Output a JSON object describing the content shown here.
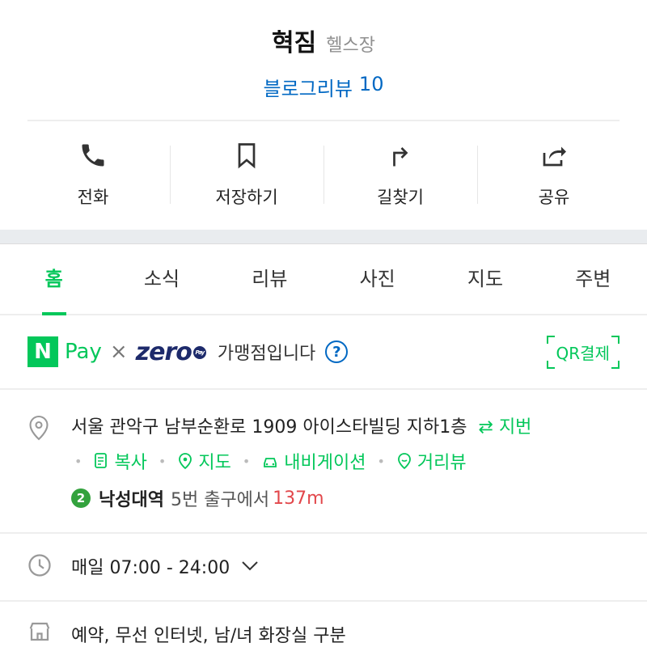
{
  "place": {
    "name": "혁짐",
    "category": "헬스장",
    "blog_review_label": "블로그리뷰",
    "blog_review_count": "10"
  },
  "actions": [
    {
      "label": "전화",
      "icon": "phone-icon"
    },
    {
      "label": "저장하기",
      "icon": "bookmark-icon"
    },
    {
      "label": "길찾기",
      "icon": "directions-icon"
    },
    {
      "label": "공유",
      "icon": "share-icon"
    }
  ],
  "tabs": [
    {
      "label": "홈",
      "active": true
    },
    {
      "label": "소식",
      "active": false
    },
    {
      "label": "리뷰",
      "active": false
    },
    {
      "label": "사진",
      "active": false
    },
    {
      "label": "지도",
      "active": false
    },
    {
      "label": "주변",
      "active": false
    }
  ],
  "payment": {
    "npay_mark": "N",
    "npay_text": "Pay",
    "x_mark": "×",
    "zero_text": "zero",
    "zero_badge": "Pay",
    "suffix": "가맹점입니다",
    "help_symbol": "?",
    "qr_label": "QR결제"
  },
  "address": {
    "text": "서울 관악구 남부순환로 1909 아이스타빌딩 지하1층",
    "jibun_label": "⇄ 지번",
    "links": [
      "복사",
      "지도",
      "내비게이션",
      "거리뷰"
    ],
    "subway_line": "2",
    "station": "낙성대역",
    "exit": "5번 출구에서",
    "distance": "137m"
  },
  "hours": {
    "text": "매일 07:00 - 24:00"
  },
  "amenities": {
    "text": "예약, 무선 인터넷, 남/녀 화장실 구분"
  },
  "colors": {
    "brand_green": "#03c75a",
    "link_blue": "#0068c3",
    "distance_red": "#e2474b",
    "line2_green": "#33a23d"
  }
}
